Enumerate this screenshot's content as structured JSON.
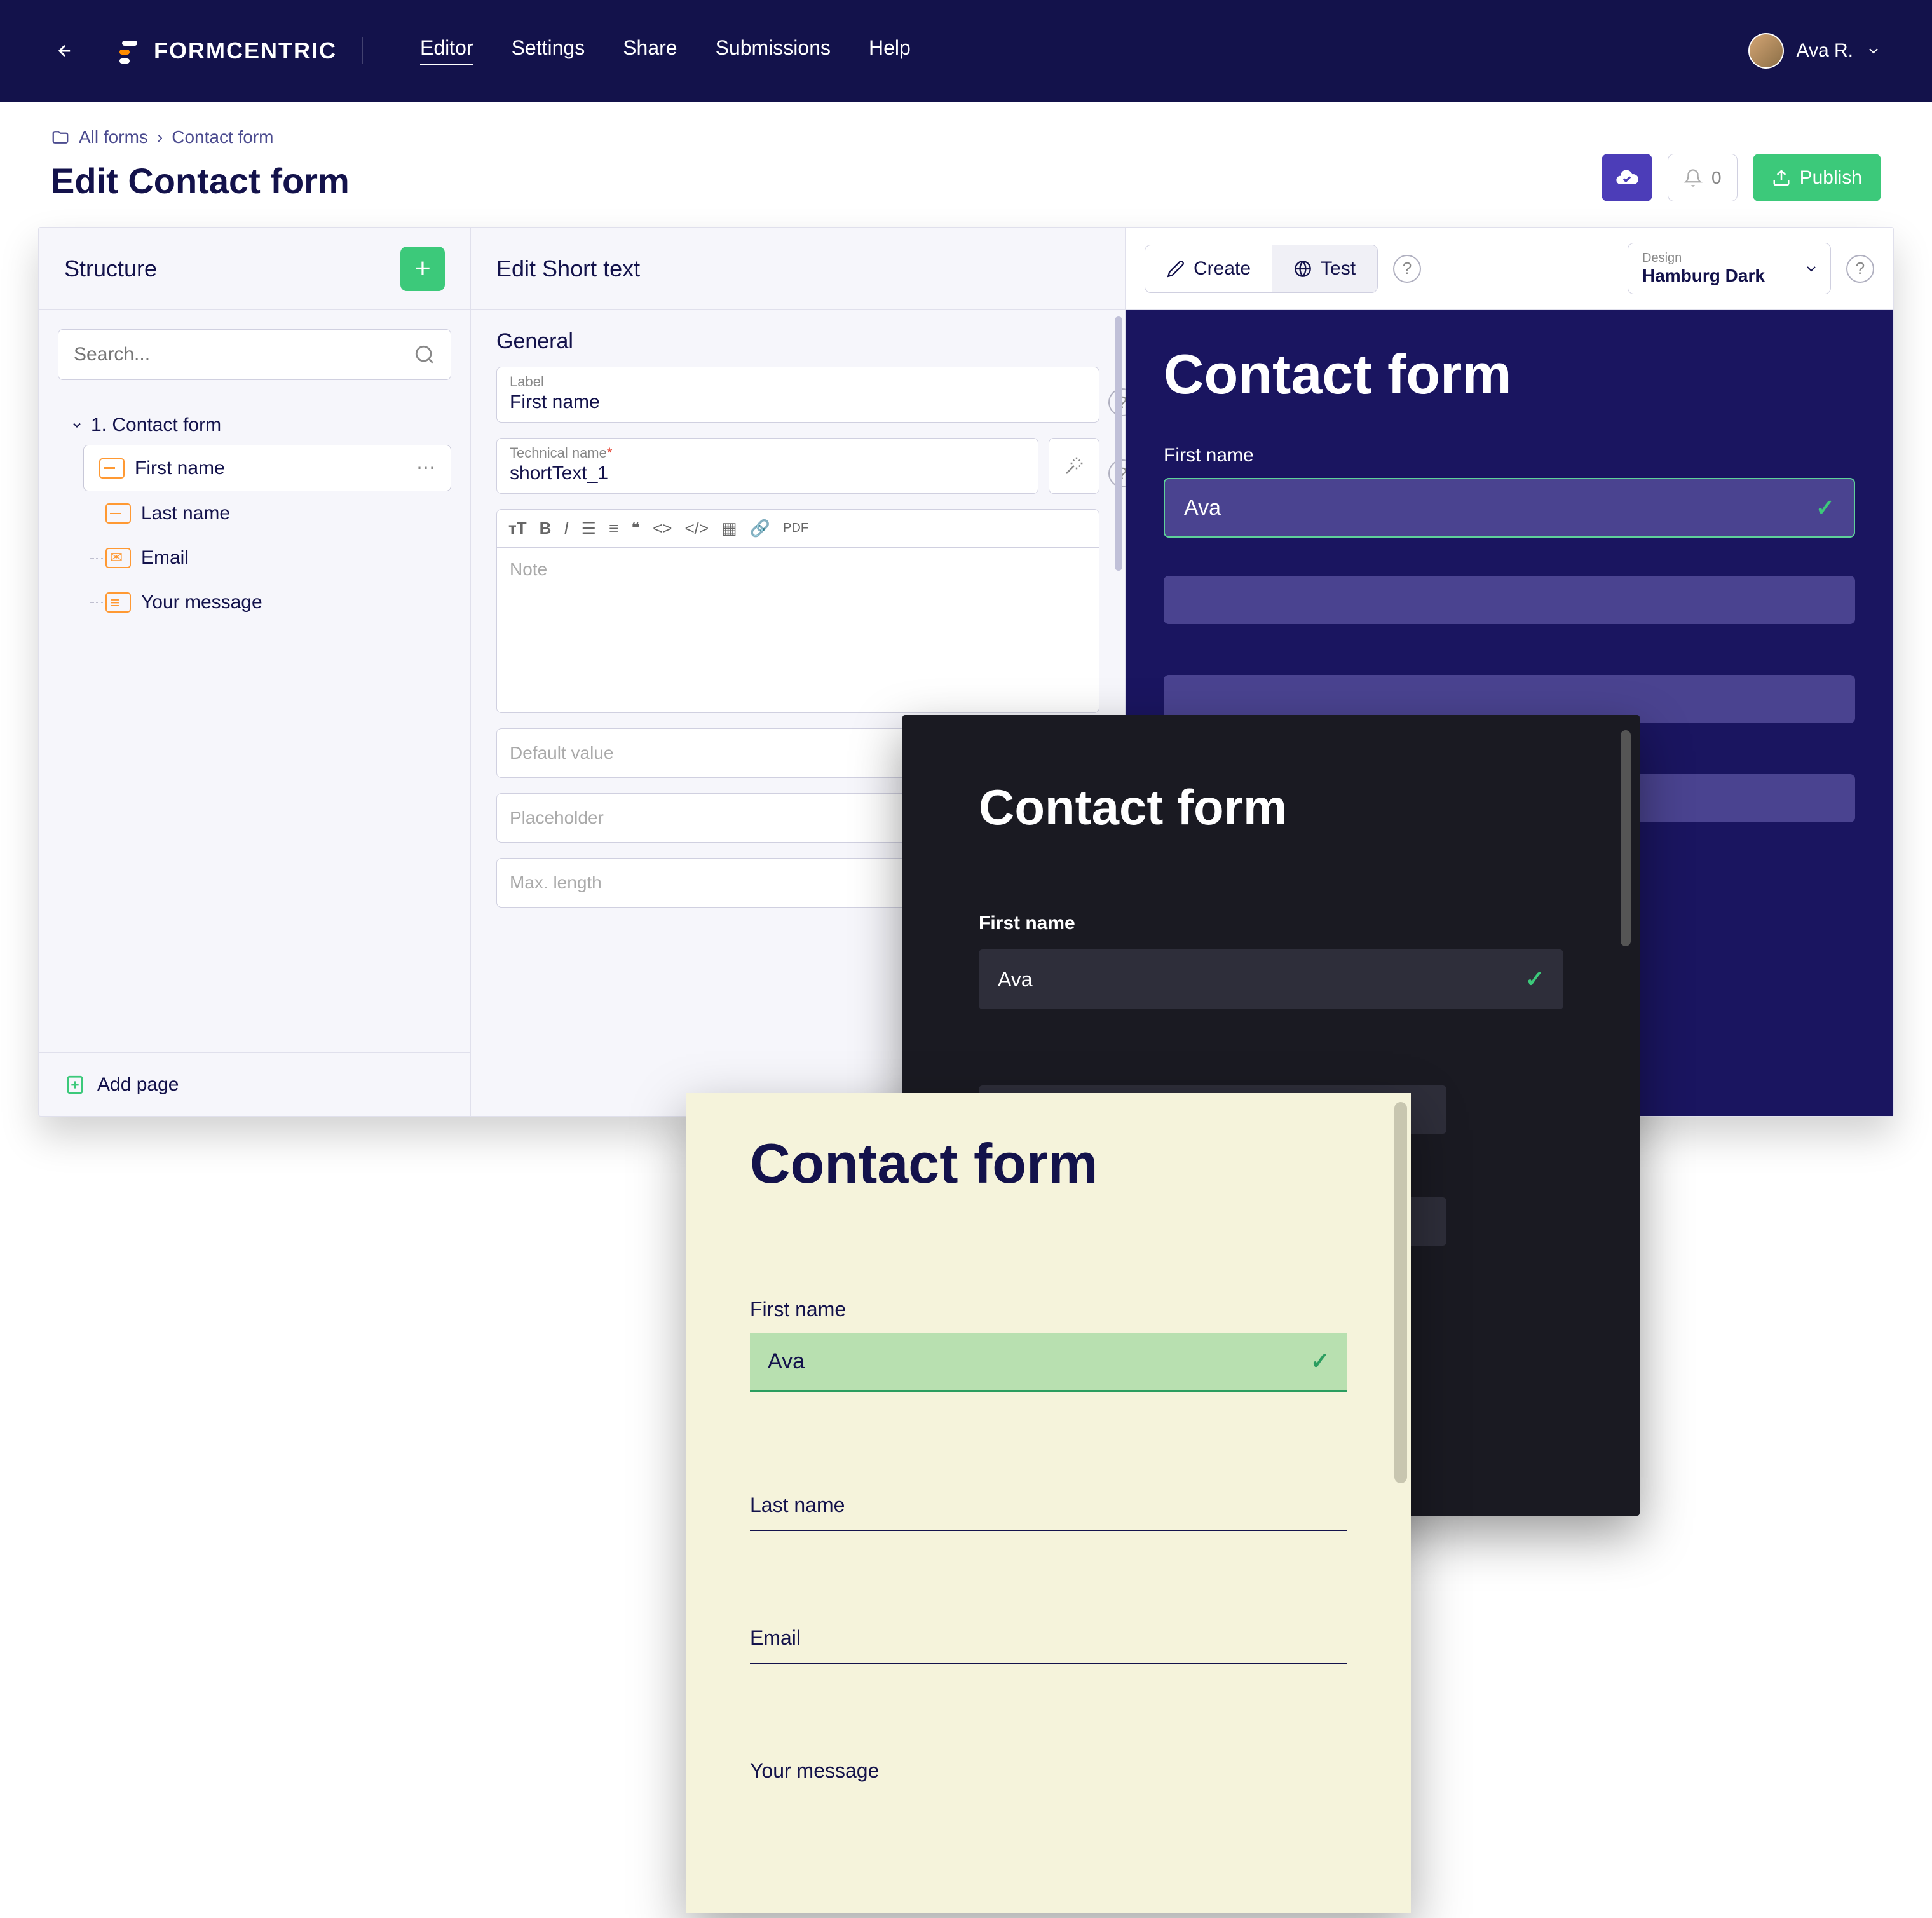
{
  "nav": {
    "brand": "FORMCENTRIC",
    "links": [
      "Editor",
      "Settings",
      "Share",
      "Submissions",
      "Help"
    ],
    "active": "Editor",
    "user": "Ava R."
  },
  "breadcrumb": {
    "root": "All forms",
    "current": "Contact form"
  },
  "page_title": "Edit Contact form",
  "actions": {
    "notif_count": "0",
    "publish": "Publish"
  },
  "structure": {
    "title": "Structure",
    "search_ph": "Search...",
    "root": "1. Contact form",
    "items": [
      "First name",
      "Last name",
      "Email",
      "Your message"
    ],
    "add_page": "Add page"
  },
  "edit": {
    "title": "Edit Short text",
    "section": "General",
    "label_lbl": "Label",
    "label_val": "First name",
    "tech_lbl": "Technical name",
    "tech_val": "shortText_1",
    "note_ph": "Note",
    "default_ph": "Default value",
    "placeholder_ph": "Placeholder",
    "maxlen_ph": "Max. length"
  },
  "preview": {
    "create": "Create",
    "test": "Test",
    "design_lbl": "Design",
    "design_val": "Hamburg Dark",
    "form_title": "Contact form",
    "first_name_lbl": "First name",
    "first_name_val": "Ava",
    "last_name_lbl": "Last name",
    "email_lbl": "Email",
    "msg_lbl": "Your message"
  }
}
